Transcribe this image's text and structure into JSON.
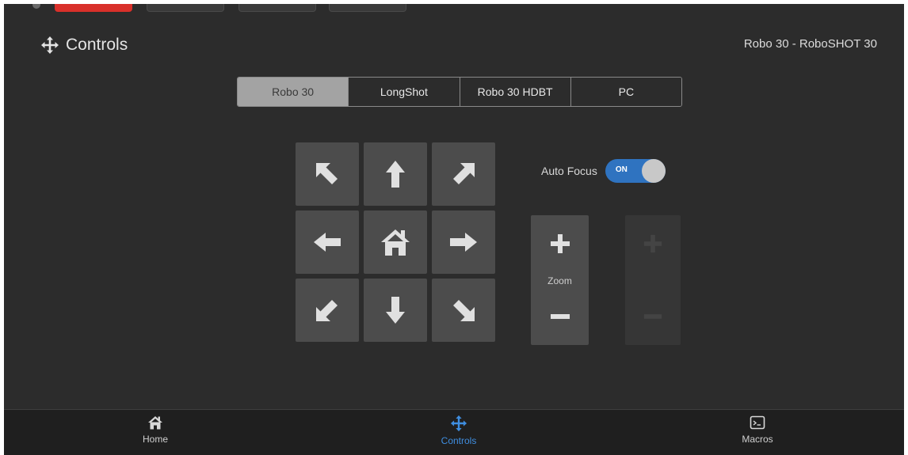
{
  "header": {
    "title": "Controls",
    "device": "Robo 30 - RoboSHOT 30"
  },
  "tabs": [
    {
      "label": "Robo 30",
      "active": true
    },
    {
      "label": "LongShot",
      "active": false
    },
    {
      "label": "Robo 30 HDBT",
      "active": false
    },
    {
      "label": "PC",
      "active": false
    }
  ],
  "autofocus": {
    "label": "Auto Focus",
    "state": "ON"
  },
  "zoom": {
    "label": "Zoom"
  },
  "nav": [
    {
      "label": "Home",
      "icon": "home-icon"
    },
    {
      "label": "Controls",
      "icon": "move-arrows-icon",
      "active": true
    },
    {
      "label": "Macros",
      "icon": "terminal-icon"
    }
  ],
  "colors": {
    "background": "#2c2c2c",
    "button": "#4c4c4c",
    "accent": "#2f73c0",
    "active_nav": "#3f8ee0",
    "active_tab": "#a3a3a3",
    "top_red": "#d9302a"
  }
}
